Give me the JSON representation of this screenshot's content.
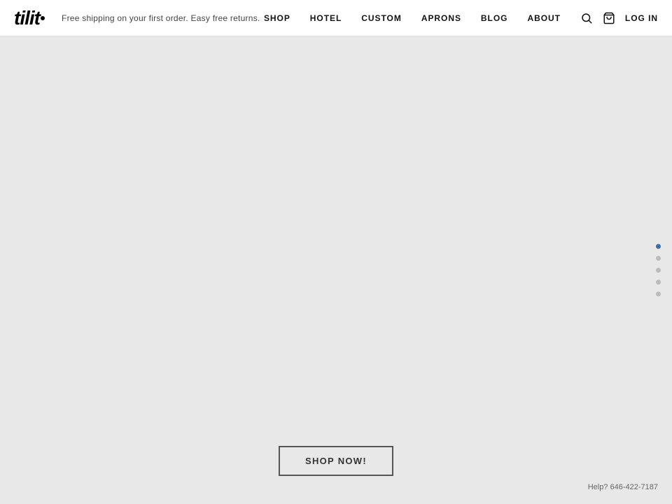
{
  "header": {
    "logo_text": "tilit",
    "tagline": "Free shipping on your first order. Easy free returns.",
    "nav_items": [
      {
        "id": "shop",
        "label": "SHOP"
      },
      {
        "id": "hotel",
        "label": "HOTEL"
      },
      {
        "id": "custom",
        "label": "CUSTOM"
      },
      {
        "id": "aprons",
        "label": "APRONS"
      },
      {
        "id": "blog",
        "label": "BLOG"
      },
      {
        "id": "about",
        "label": "ABOUT"
      }
    ],
    "login_label": "LOG IN"
  },
  "slideshow": {
    "dots": [
      {
        "id": "dot-1",
        "active": true
      },
      {
        "id": "dot-2",
        "active": false
      },
      {
        "id": "dot-3",
        "active": false
      },
      {
        "id": "dot-4",
        "active": false
      },
      {
        "id": "dot-5",
        "active": false
      }
    ]
  },
  "cta": {
    "button_label": "SHOP NOW!"
  },
  "footer": {
    "help_text": "Help? 646-422-7187"
  }
}
